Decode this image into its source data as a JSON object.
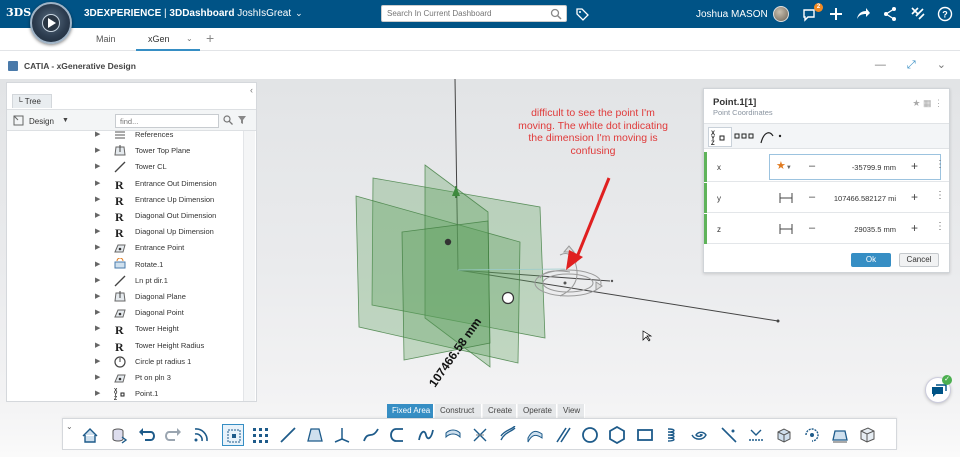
{
  "topbar": {
    "brand_logo": "3DS",
    "platform": "3DEXPERIENCE",
    "separator": " | ",
    "app": "3DDashboard",
    "dashboard": "JoshIsGreat",
    "search_placeholder": "Search In Current Dashboard",
    "user_name": "Joshua MASON",
    "notification_count": "2",
    "icons": [
      "tag-icon",
      "notifications-icon",
      "add-icon",
      "share-icon",
      "network-icon",
      "tools-icon",
      "help-icon"
    ]
  },
  "tabs": {
    "items": [
      "Main",
      "xGen"
    ],
    "active": "xGen"
  },
  "app_header": {
    "title": "CATIA - xGenerative Design"
  },
  "tree": {
    "tab_label": "Tree",
    "mode_label": "Design",
    "find_placeholder": "find...",
    "items": [
      {
        "label": "References",
        "icon": "references-icon"
      },
      {
        "label": "Tower Top Plane",
        "icon": "plane-icon"
      },
      {
        "label": "Tower CL",
        "icon": "line-icon"
      },
      {
        "label": "Entrance Out Dimension",
        "icon": "real-parameter-icon"
      },
      {
        "label": "Entrance Up Dimension",
        "icon": "real-parameter-icon"
      },
      {
        "label": "Diagonal Out Dimension",
        "icon": "real-parameter-icon"
      },
      {
        "label": "Diagonal Up Dimension",
        "icon": "real-parameter-icon"
      },
      {
        "label": "Entrance Point",
        "icon": "point-icon"
      },
      {
        "label": "Rotate.1",
        "icon": "rotate-icon"
      },
      {
        "label": "Ln pt dir.1",
        "icon": "line-icon"
      },
      {
        "label": "Diagonal Plane",
        "icon": "plane-icon"
      },
      {
        "label": "Diagonal Point",
        "icon": "point-icon"
      },
      {
        "label": "Tower Height",
        "icon": "real-parameter-icon"
      },
      {
        "label": "Tower Height Radius",
        "icon": "real-parameter-icon"
      },
      {
        "label": "Circle pt radius 1",
        "icon": "circle-icon"
      },
      {
        "label": "Pt on pln 3",
        "icon": "point-icon"
      },
      {
        "label": "Point.1",
        "icon": "point-xyz-icon"
      }
    ]
  },
  "annotation": {
    "text": "difficult to see the point I'm moving. The white dot indicating the dimension I'm moving is confusing",
    "color": "#e03a3a"
  },
  "viewport": {
    "dimension_label": "107466.58 mm"
  },
  "properties": {
    "title": "Point.1[1]",
    "subtitle": "Point Coordinates",
    "coords": [
      {
        "label": "x",
        "value": "-35799.9 mm"
      },
      {
        "label": "y",
        "value": "107466.582127 mi"
      },
      {
        "label": "z",
        "value": "29035.5 mm"
      }
    ],
    "ok_label": "Ok",
    "cancel_label": "Cancel"
  },
  "section_tabs": {
    "items": [
      "Fixed Area",
      "Construct",
      "Create",
      "Operate",
      "View"
    ],
    "active": "Fixed Area"
  },
  "action_bar": {
    "icons": [
      "home-icon",
      "save-icon",
      "undo-icon",
      "redo-icon",
      "feed-icon",
      "point-icon",
      "points-grid-icon",
      "line-icon",
      "plane-icon",
      "axis-icon",
      "curve-icon",
      "connect-curve-icon",
      "spline-icon",
      "extrude-icon",
      "sweep-icon",
      "multi-sweep-icon",
      "blend-icon",
      "lines-icon",
      "circle-icon",
      "hexagon-icon",
      "rectangle-icon",
      "helix-icon",
      "spiral-icon",
      "intersect-icon",
      "project-icon",
      "box-icon",
      "rotate-icon",
      "plane-tool-icon",
      "cube-icon"
    ],
    "selected": "point-icon"
  },
  "colors": {
    "topbar": "#005386",
    "accent": "#368ec4",
    "plane_green": "#5a9e5a",
    "status_green": "#5fb35a"
  }
}
